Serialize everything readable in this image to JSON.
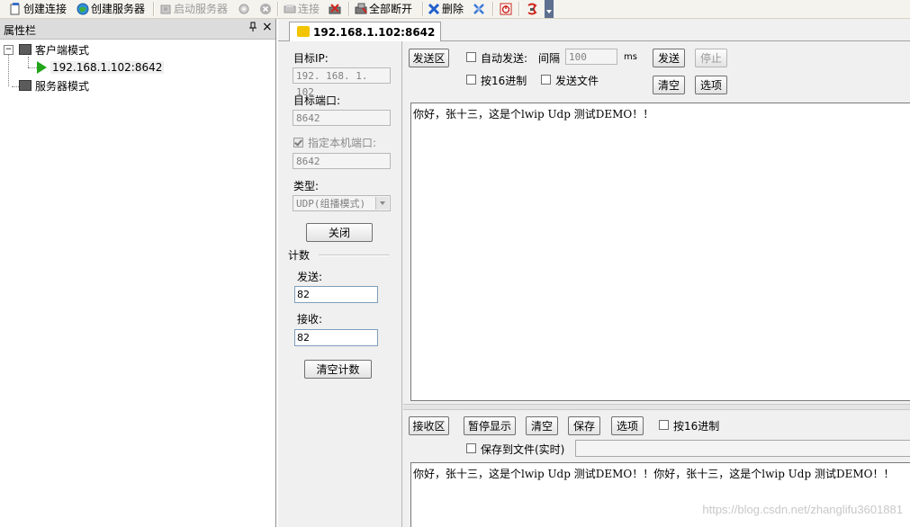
{
  "toolbar": {
    "items": [
      {
        "label": "创建连接",
        "icon": "new-connection-icon",
        "enabled": true
      },
      {
        "label": "创建服务器",
        "icon": "globe-server-icon",
        "enabled": true
      },
      {
        "label": "启动服务器",
        "icon": "start-server-icon",
        "enabled": false
      },
      {
        "label": "连接",
        "icon": "connect-icon",
        "enabled": false
      },
      {
        "label": "全部断开",
        "icon": "disconnect-all-icon",
        "enabled": true
      },
      {
        "label": "删除",
        "icon": "delete-icon",
        "enabled": true
      }
    ]
  },
  "left_panel": {
    "title": "属性栏",
    "pin_glyph": "ᵖ",
    "close_glyph": "×",
    "tree": {
      "client_mode": "客户端模式",
      "client_connection": "192.168.1.102:8642",
      "server_mode": "服务器模式"
    }
  },
  "tab": {
    "label": "192.168.1.102:8642"
  },
  "settings": {
    "target_ip_label": "目标IP:",
    "target_ip_value": "192. 168. 1. 102",
    "target_port_label": "目标端口:",
    "target_port_value": "8642",
    "local_port_label": "指定本机端口:",
    "local_port_checked": true,
    "local_port_value": "8642",
    "type_label": "类型:",
    "type_value": "UDP(组播模式)",
    "close_button": "关闭",
    "counter_label": "计数",
    "send_count_label": "发送:",
    "send_count_value": "82",
    "recv_count_label": "接收:",
    "recv_count_value": "82",
    "clear_count_button": "清空计数"
  },
  "send": {
    "area_button": "发送区",
    "auto_send_label": "自动发送:",
    "interval_label": "间隔",
    "interval_value": "100",
    "interval_unit": "ms",
    "send_button": "发送",
    "stop_button": "停止",
    "hex_label": "按16进制",
    "send_file_label": "发送文件",
    "clear_button": "清空",
    "options_button": "选项",
    "text": "你好，张十三，这是个lwip Udp 测试DEMO！！"
  },
  "receive": {
    "area_button": "接收区",
    "pause_button": "暂停显示",
    "clear_button": "清空",
    "save_button": "保存",
    "options_button": "选项",
    "hex_label": "按16进制",
    "save_to_file_label": "保存到文件(实时)",
    "text": "你好，张十三，这是个lwip Udp 测试DEMO！！你好，张十三，这是个lwip Udp 测试DEMO！！"
  },
  "watermark": "https://blog.csdn.net/zhanglifu3601881"
}
